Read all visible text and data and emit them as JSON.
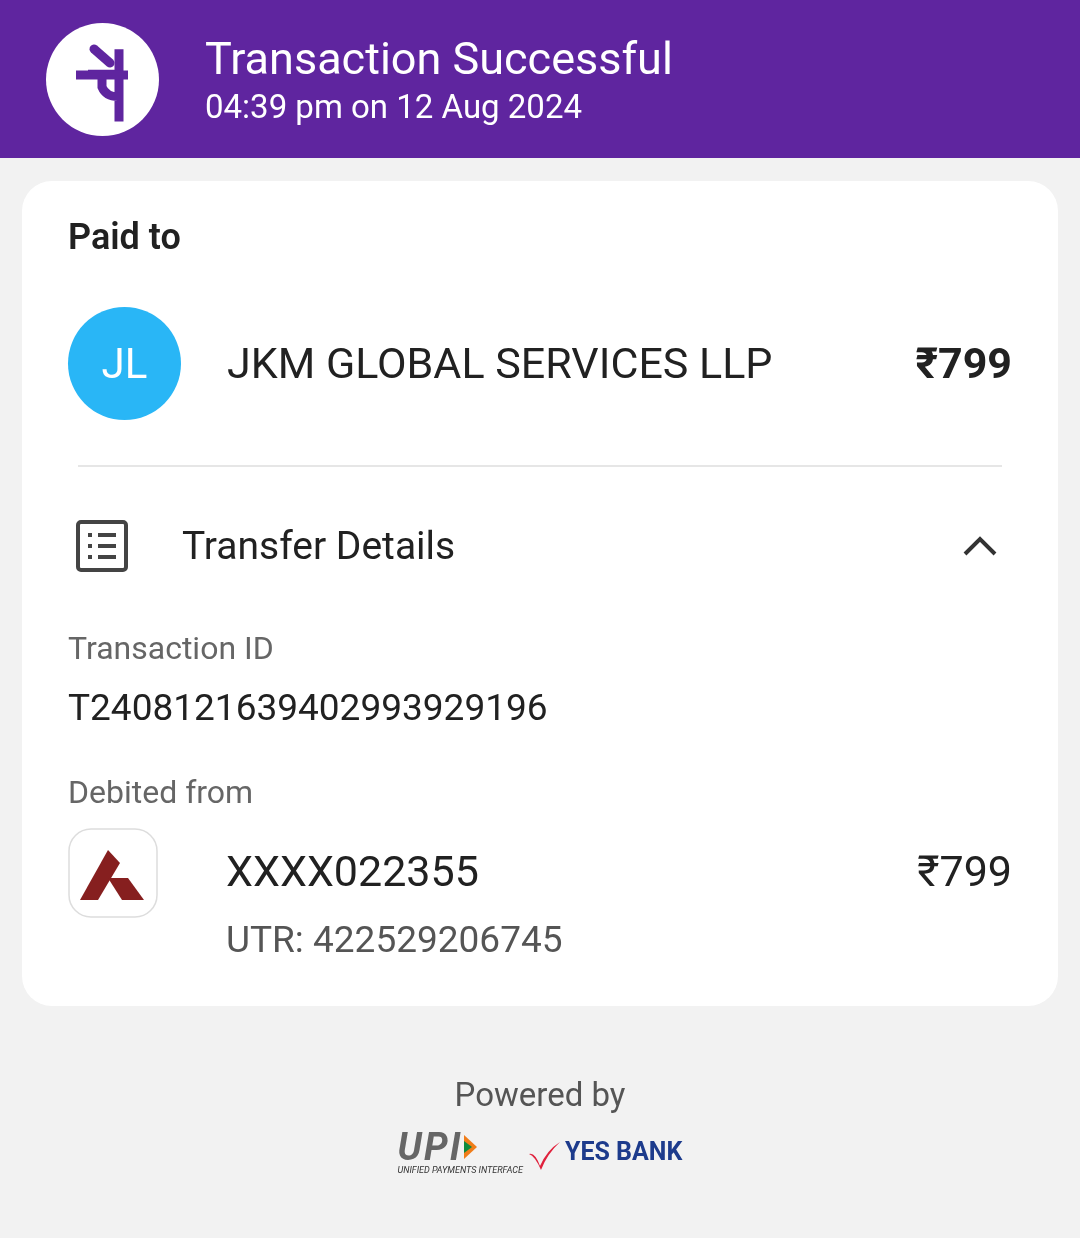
{
  "header": {
    "title": "Transaction Successful",
    "subtitle": "04:39 pm on 12 Aug 2024"
  },
  "paid_to": {
    "label": "Paid to",
    "avatar_initials": "JL",
    "payee": "JKM GLOBAL SERVICES LLP",
    "amount": "₹799"
  },
  "transfer_details": {
    "title": "Transfer Details",
    "expanded": true,
    "transaction_id_label": "Transaction ID",
    "transaction_id": "T2408121639402993929196",
    "debited_label": "Debited from",
    "account": "XXXX022355",
    "account_amount": "₹799",
    "utr": "UTR: 422529206745"
  },
  "footer": {
    "powered_by": "Powered by",
    "upi": "UPI",
    "upi_subtitle": "UNIFIED PAYMENTS INTERFACE",
    "bank": "YES BANK"
  }
}
